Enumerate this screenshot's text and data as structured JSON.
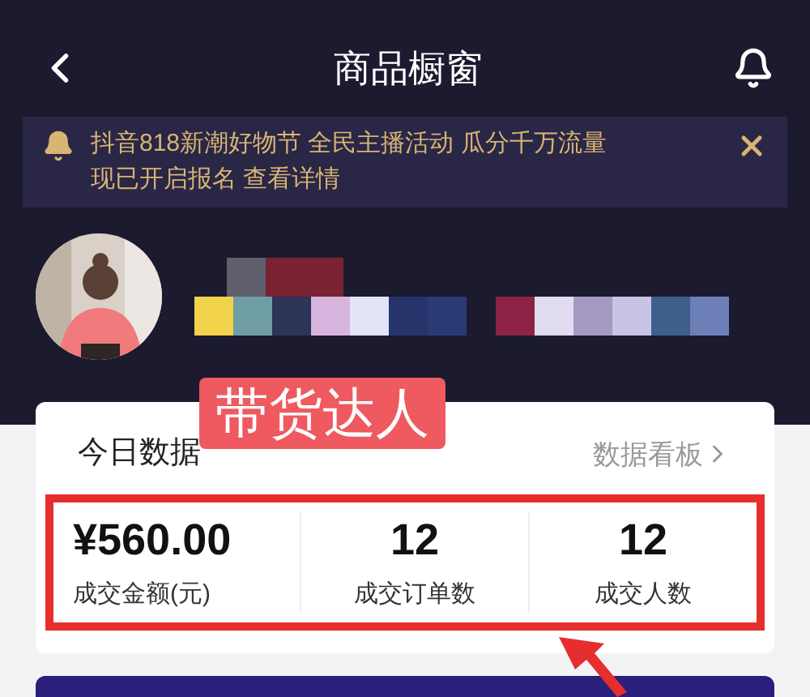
{
  "header": {
    "title": "商品橱窗"
  },
  "notice": {
    "text": "抖音818新潮好物节 全民主播活动 瓜分千万流量现已开启报名",
    "link": "查看详情"
  },
  "card": {
    "title": "今日数据",
    "link": "数据看板",
    "stats": [
      {
        "value": "¥560.00",
        "label": "成交金额(元)"
      },
      {
        "value": "12",
        "label": "成交订单数"
      },
      {
        "value": "12",
        "label": "成交人数"
      }
    ]
  },
  "annotation": {
    "label": "带货达人"
  }
}
